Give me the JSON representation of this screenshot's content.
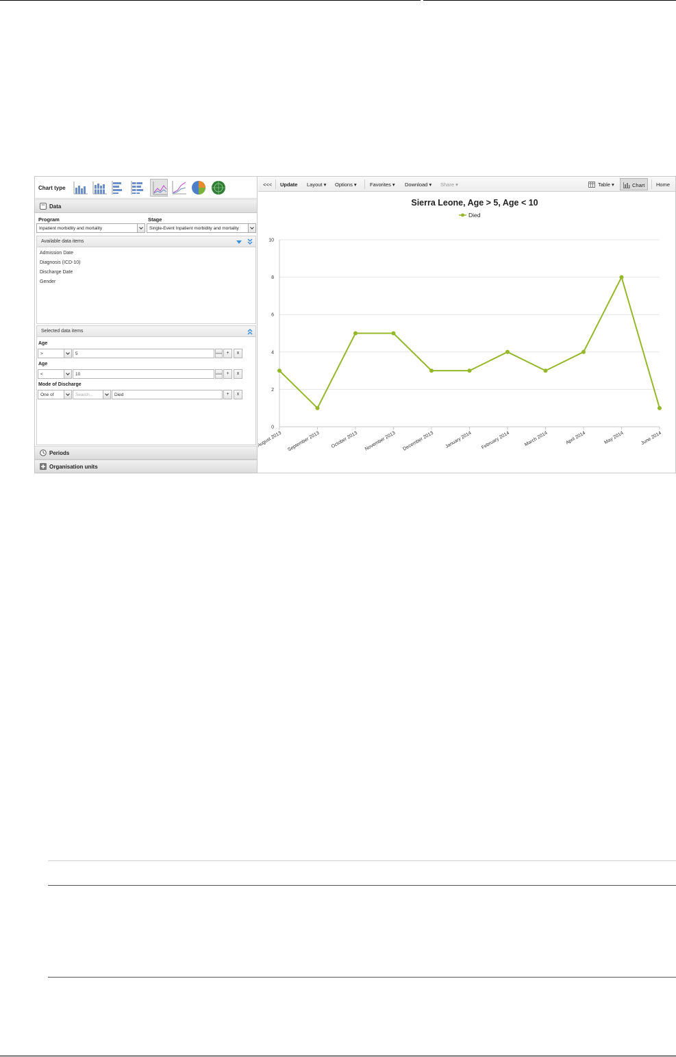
{
  "left_panel": {
    "chart_type_label": "Chart type",
    "chart_type_icons": [
      "column-chart-icon",
      "stacked-column-chart-icon",
      "bar-chart-icon",
      "stacked-bar-chart-icon",
      "line-chart-icon",
      "area-chart-icon",
      "pie-chart-icon",
      "radar-chart-icon"
    ],
    "active_chart_type": "line-chart-icon",
    "data_section": {
      "title": "Data",
      "program_label": "Program",
      "program_value": "Inpatient morbidity and mortality",
      "stage_label": "Stage",
      "stage_value": "Single-Event Inpatient morbidity and mortality",
      "available_title": "Available data items",
      "available_items": [
        "Admission Date",
        "Diagnosis (ICD-10)",
        "Discharge Date",
        "Gender"
      ],
      "selected_title": "Selected data items",
      "selected_items": [
        {
          "label": "Age",
          "operator": ">",
          "value": "5",
          "add": "+",
          "remove": "x"
        },
        {
          "label": "Age",
          "operator": "<",
          "value": "10",
          "add": "+",
          "remove": "x"
        }
      ],
      "mode": {
        "label": "Mode of Discharge",
        "operator": "One of",
        "search_placeholder": "Search...",
        "value": "Died",
        "add": "+",
        "remove": "x"
      }
    },
    "periods_title": "Periods",
    "org_units_title": "Organisation units"
  },
  "toolbar": {
    "collapse": "<<<",
    "update": "Update",
    "layout": "Layout ▾",
    "options": "Options ▾",
    "favorites": "Favorites ▾",
    "download": "Download ▾",
    "share": "Share ▾",
    "table": "Table ▾",
    "chart": "Chart",
    "home": "Home"
  },
  "colors": {
    "series": "#94b82a",
    "grid": "#e6e6e6"
  },
  "chart_data": {
    "type": "line",
    "title": "Sierra Leone, Age > 5, Age < 10",
    "categories": [
      "August 2013",
      "September 2013",
      "October 2013",
      "November 2013",
      "December 2013",
      "January 2014",
      "February 2014",
      "March 2014",
      "April 2014",
      "May 2014",
      "June 2014"
    ],
    "series": [
      {
        "name": "Died",
        "values": [
          3,
          1,
          5,
          5,
          3,
          3,
          4,
          3,
          4,
          8,
          1
        ]
      }
    ],
    "ylim": [
      0,
      10
    ],
    "yticks": [
      0,
      2,
      4,
      6,
      8,
      10
    ],
    "grid": true,
    "legend": "top-center"
  }
}
